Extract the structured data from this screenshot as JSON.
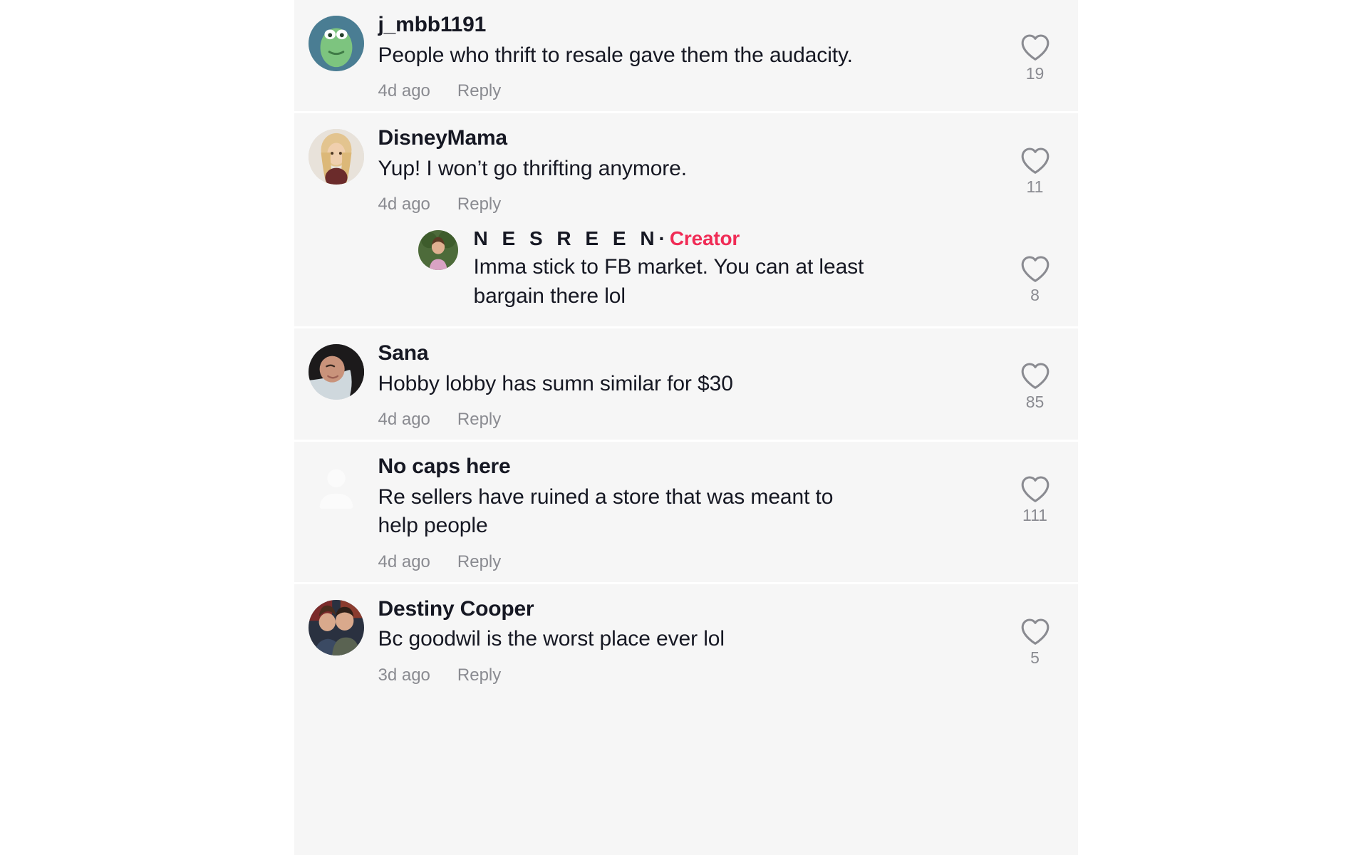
{
  "app": {
    "name": "tiktok-comments",
    "accent_color": "#f02c56",
    "text_color": "#161823",
    "muted_color": "#8a8b91",
    "panel_bg": "#f6f6f6",
    "page_bg": "#ffffff"
  },
  "labels": {
    "reply": "Reply",
    "like_icon": "heart-icon",
    "creator_badge": "Creator",
    "creator_separator": "·"
  },
  "comments": [
    {
      "username": "j_mbb1191",
      "text": "People who thrift to resale gave them the audacity.",
      "time": "4d ago",
      "reply": "Reply",
      "likes": "19",
      "avatar": "frog-avatar"
    },
    {
      "username": "DisneyMama",
      "text": "Yup! I won’t go thrifting anymore.",
      "time": "4d ago",
      "reply": "Reply",
      "likes": "11",
      "avatar": "blonde-woman-avatar",
      "reply_comment": {
        "username": "N E S R E E N",
        "badge": "Creator",
        "separator": "·",
        "text": "Imma stick to FB market. You can at least bargain there lol",
        "likes": "8",
        "avatar": "creator-avatar"
      }
    },
    {
      "username": "Sana",
      "text": "Hobby lobby has sumn similar for $30",
      "time": "4d ago",
      "reply": "Reply",
      "likes": "85",
      "avatar": "dark-hair-woman-avatar"
    },
    {
      "username": "No caps here",
      "text": "Re sellers have ruined a store that was meant to help people",
      "time": "4d ago",
      "reply": "Reply",
      "likes": "111",
      "avatar": "default-person-avatar"
    },
    {
      "username": "Destiny Cooper",
      "text": "Bc goodwil is the worst place ever lol",
      "time": "3d ago",
      "reply": "Reply",
      "likes": "5",
      "avatar": "couple-avatar"
    }
  ]
}
